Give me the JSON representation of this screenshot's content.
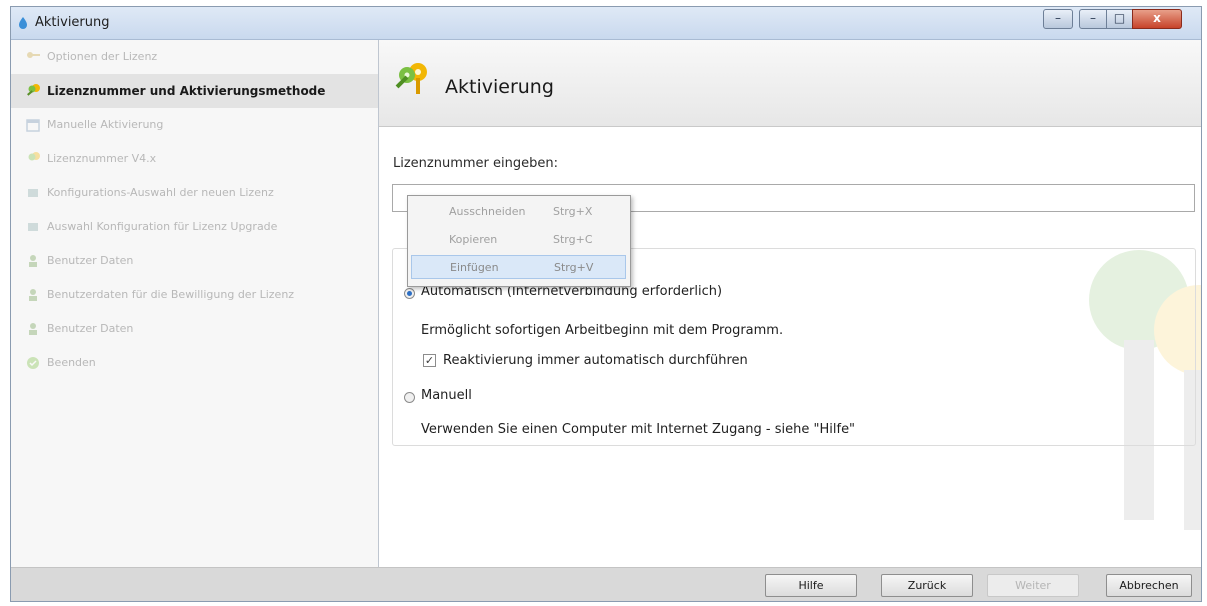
{
  "window": {
    "title": "Aktivierung",
    "close_label": "x"
  },
  "sidebar": {
    "items": [
      {
        "label": "Optionen der Lizenz",
        "active": false
      },
      {
        "label": "Lizenznummer und Aktivierungsmethode",
        "active": true
      },
      {
        "label": "Manuelle Aktivierung",
        "active": false
      },
      {
        "label": "Lizenznummer V4.x",
        "active": false
      },
      {
        "label": "Konfigurations-Auswahl der neuen Lizenz",
        "active": false
      },
      {
        "label": "Auswahl Konfiguration für Lizenz Upgrade",
        "active": false
      },
      {
        "label": "Benutzer Daten",
        "active": false
      },
      {
        "label": "Benutzerdaten für die Bewilligung der Lizenz",
        "active": false
      },
      {
        "label": "Benutzer Daten",
        "active": false
      },
      {
        "label": "Beenden",
        "active": false
      }
    ]
  },
  "header": {
    "title": "Aktivierung"
  },
  "form": {
    "license_label": "Lizenznummer eingeben:",
    "license_value": "",
    "option_auto": "Automatisch (Internetverbindung erforderlich)",
    "option_auto_desc": "Ermöglicht sofortigen Arbeitbeginn mit dem Programm.",
    "reactivate_label": "Reaktivierung immer automatisch durchführen",
    "reactivate_checked": true,
    "option_manual": "Manuell",
    "option_manual_desc": "Verwenden Sie einen Computer mit Internet Zugang - siehe \"Hilfe\""
  },
  "context_menu": {
    "items": [
      {
        "label": "Ausschneiden",
        "shortcut": "Strg+X"
      },
      {
        "label": "Kopieren",
        "shortcut": "Strg+C"
      },
      {
        "label": "Einfügen",
        "shortcut": "Strg+V"
      }
    ]
  },
  "footer": {
    "help": "Hilfe",
    "back": "Zurück",
    "next": "Weiter",
    "cancel": "Abbrechen"
  },
  "colors": {
    "accent": "#2d6fc4",
    "highlight": "#dae8f8",
    "sidebar_active": "#e3e3e3"
  }
}
